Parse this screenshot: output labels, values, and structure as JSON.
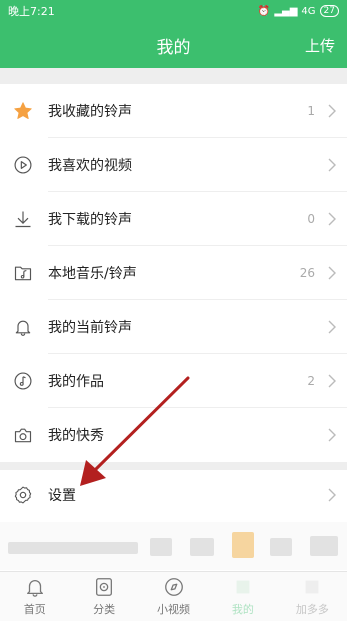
{
  "status_bar": {
    "time": "晚上7:21",
    "network": "4G",
    "battery": "27"
  },
  "header": {
    "title": "我的",
    "upload_label": "上传"
  },
  "menu_items": [
    {
      "label": "我收藏的铃声",
      "count": "1",
      "icon": "star-icon"
    },
    {
      "label": "我喜欢的视频",
      "count": "",
      "icon": "play-circle-icon"
    },
    {
      "label": "我下载的铃声",
      "count": "0",
      "icon": "download-icon"
    },
    {
      "label": "本地音乐/铃声",
      "count": "26",
      "icon": "music-folder-icon"
    },
    {
      "label": "我的当前铃声",
      "count": "",
      "icon": "bell-icon"
    },
    {
      "label": "我的作品",
      "count": "2",
      "icon": "music-note-icon"
    },
    {
      "label": "我的快秀",
      "count": "",
      "icon": "camera-icon"
    }
  ],
  "settings": {
    "label": "设置",
    "icon": "gear-icon"
  },
  "tabbar": {
    "tabs": [
      {
        "label": "首页",
        "icon": "bell-icon"
      },
      {
        "label": "分类",
        "icon": "disc-icon"
      },
      {
        "label": "小视频",
        "icon": "compass-icon"
      },
      {
        "label": "我的",
        "icon": "user-icon",
        "active": true
      },
      {
        "label": "加多多",
        "icon": "plus-icon"
      }
    ]
  },
  "colors": {
    "accent": "#3cbf6e",
    "star": "#f5a142",
    "arrow": "#b3201f"
  }
}
